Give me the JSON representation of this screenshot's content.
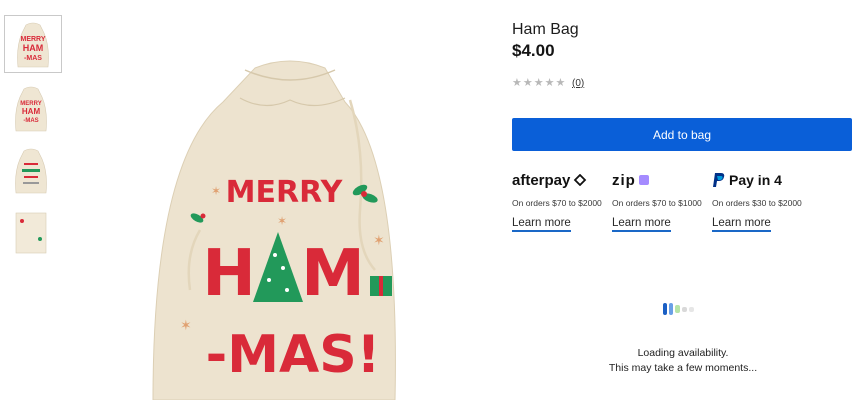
{
  "thumbnails": [
    {
      "name": "thumbnail-1",
      "active": true
    },
    {
      "name": "thumbnail-2",
      "active": false
    },
    {
      "name": "thumbnail-3",
      "active": false
    },
    {
      "name": "thumbnail-4",
      "active": false
    }
  ],
  "product": {
    "title": "Ham Bag",
    "price": "$4.00",
    "stars": "★★★★★",
    "rating": 0,
    "review_count": "(0)",
    "add_to_bag": "Add to bag"
  },
  "bag_print": {
    "line1": "MERRY",
    "line2_a": "H",
    "line2_b": "M",
    "line3": "-MAS!"
  },
  "payments": [
    {
      "logo": "afterpay",
      "desc": "On orders $70 to $2000",
      "learn": "Learn more"
    },
    {
      "logo": "zip",
      "desc": "On orders $70 to $1000",
      "learn": "Learn more"
    },
    {
      "logo": "Pay in 4",
      "desc": "On orders $30 to $2000",
      "learn": "Learn more"
    }
  ],
  "availability": {
    "line1": "Loading availability.",
    "line2": "This may take a few moments..."
  },
  "colors": {
    "accent": "#0a5fd8",
    "learn_underline": "#1a68c7",
    "bag_red": "#d92a39",
    "bag_green": "#22995a",
    "bag_canvas": "#ede3cf"
  }
}
